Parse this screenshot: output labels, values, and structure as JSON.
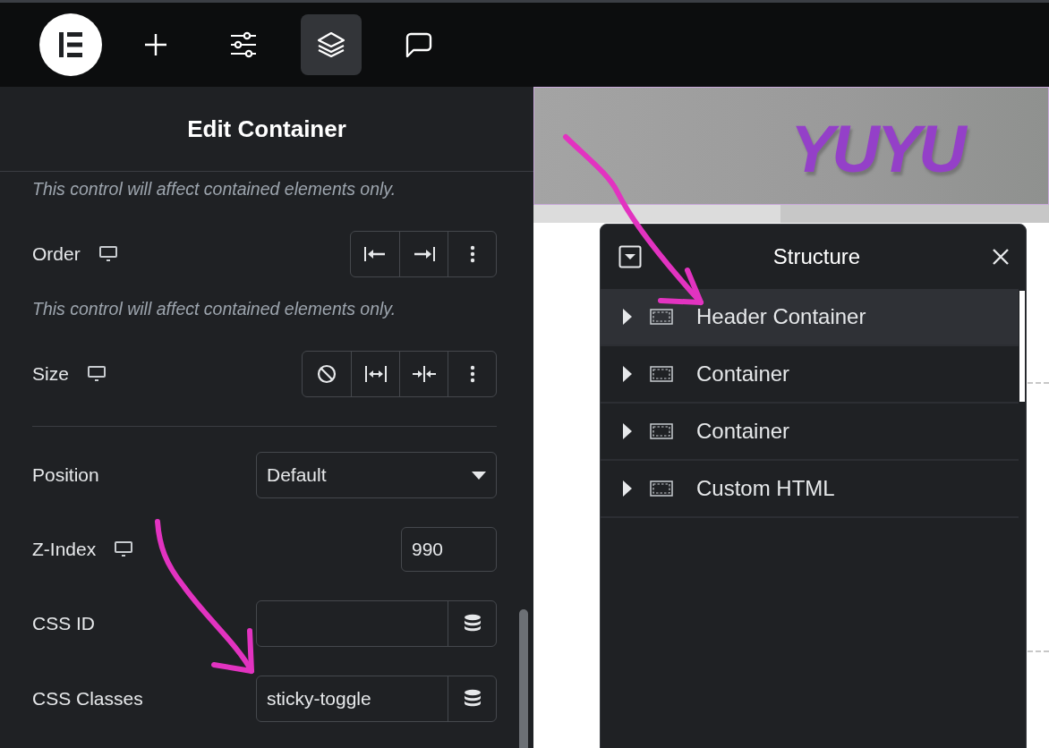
{
  "toolbar": {
    "items": [
      {
        "kind": "logo",
        "selected": false
      },
      {
        "kind": "add",
        "selected": false
      },
      {
        "kind": "settings",
        "selected": false
      },
      {
        "kind": "layers",
        "selected": true
      },
      {
        "kind": "comment",
        "selected": false
      }
    ]
  },
  "panel": {
    "title": "Edit Container",
    "controls": [
      {
        "kind": "note",
        "text": "This control will affect contained elements only."
      },
      {
        "kind": "buttongroup",
        "label": "Order",
        "responsive": true,
        "buttons": [
          {
            "kind": "start"
          },
          {
            "kind": "end"
          },
          {
            "kind": "more"
          }
        ]
      },
      {
        "kind": "note",
        "text": "This control will affect contained elements only."
      },
      {
        "kind": "buttongroup",
        "label": "Size",
        "responsive": true,
        "buttons": [
          {
            "kind": "none"
          },
          {
            "kind": "grow"
          },
          {
            "kind": "shrink"
          },
          {
            "kind": "more"
          }
        ]
      },
      {
        "kind": "divider"
      },
      {
        "kind": "select",
        "label": "Position",
        "value": "Default"
      },
      {
        "kind": "number",
        "label": "Z-Index",
        "responsive": true,
        "value": "990"
      },
      {
        "kind": "dynamic",
        "label": "CSS ID"
      },
      {
        "kind": "dynamic",
        "label": "CSS Classes",
        "value": "sticky-toggle"
      }
    ]
  },
  "preview": {
    "logo": "YUYU"
  },
  "structure": {
    "title": "Structure",
    "items": [
      {
        "label": "Header Container",
        "selected": true
      },
      {
        "label": "Container",
        "selected": false
      },
      {
        "label": "Container",
        "selected": false
      },
      {
        "label": "Custom HTML",
        "selected": false
      }
    ]
  }
}
